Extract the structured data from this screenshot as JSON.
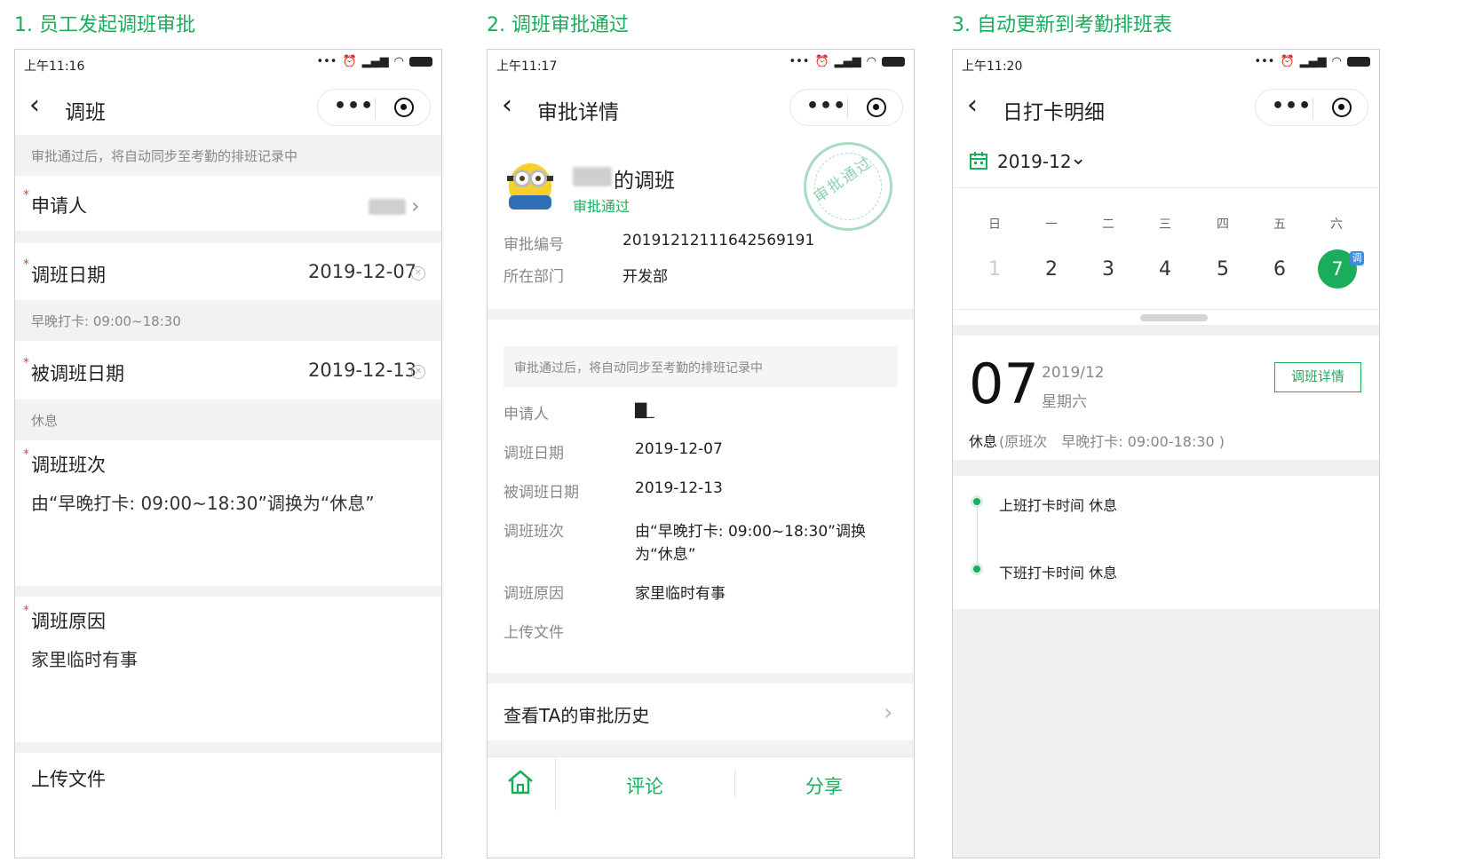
{
  "steps": {
    "s1": "1. 员工发起调班审批",
    "s2": "2. 调班审批通过",
    "s3": "3. 自动更新到考勤排班表"
  },
  "colors": {
    "accent": "#1aad5c",
    "required": "#e64340"
  },
  "p1": {
    "time": "上午11:16",
    "title": "调班",
    "notice": "审批通过后，将自动同步至考勤的排班记录中",
    "applicant_label": "申请人",
    "date_label": "调班日期",
    "date_value": "2019-12-07",
    "date_shift": "早晚打卡: 09:00~18:30",
    "target_label": "被调班日期",
    "target_value": "2019-12-13",
    "target_shift": "休息",
    "shift_label": "调班班次",
    "shift_value": "由“早晚打卡: 09:00~18:30”调换为“休息”",
    "reason_label": "调班原因",
    "reason_value": "家里临时有事",
    "upload_label": "上传文件"
  },
  "p2": {
    "time": "上午11:17",
    "title": "审批详情",
    "heading_suffix": "的调班",
    "status": "审批通过",
    "stamp": "审批通过",
    "no_label": "审批编号",
    "no_value": "20191212111642569191",
    "dept_label": "所在部门",
    "dept_value": "开发部",
    "notice": "审批通过后，将自动同步至考勤的排班记录中",
    "applicant_label": "申请人",
    "applicant_value": "▇_",
    "date_label": "调班日期",
    "date_value": "2019-12-07",
    "target_label": "被调班日期",
    "target_value": "2019-12-13",
    "shift_label": "调班班次",
    "shift_value_line1": "由“早晚打卡: 09:00~18:30”调换",
    "shift_value_line2": "为“休息”",
    "reason_label": "调班原因",
    "reason_value": "家里临时有事",
    "upload_label": "上传文件",
    "history": "查看TA的审批历史",
    "comment": "评论",
    "share": "分享"
  },
  "p3": {
    "time": "上午11:20",
    "title": "日打卡明细",
    "month": "2019-12",
    "weekdays": [
      "日",
      "一",
      "二",
      "三",
      "四",
      "五",
      "六"
    ],
    "days": [
      "1",
      "2",
      "3",
      "4",
      "5",
      "6",
      "7"
    ],
    "badge": "调",
    "big_day": "07",
    "ym": "2019/12",
    "weekday": "星期六",
    "detail_button": "调班详情",
    "rest_prefix": "休息",
    "rest_orig": "(原班次　早晚打卡: 09:00-18:30 )",
    "clock_in": "上班打卡时间 休息",
    "clock_out": "下班打卡时间 休息"
  }
}
